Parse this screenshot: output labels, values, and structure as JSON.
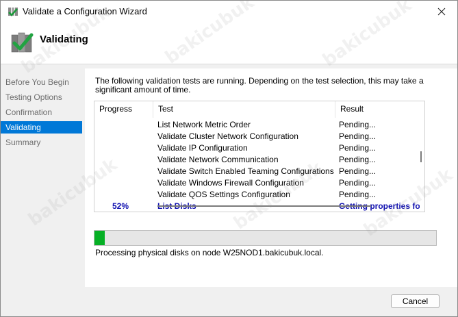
{
  "window": {
    "title": "Validate a Configuration Wizard"
  },
  "header": {
    "title": "Validating"
  },
  "sidebar": {
    "items": [
      {
        "label": "Before You Begin",
        "active": false
      },
      {
        "label": "Testing Options",
        "active": false
      },
      {
        "label": "Confirmation",
        "active": false
      },
      {
        "label": "Validating",
        "active": true
      },
      {
        "label": "Summary",
        "active": false
      }
    ]
  },
  "main": {
    "intro": "The following validation tests are running. Depending on the test selection, this may take a significant amount of time.",
    "columns": {
      "progress": "Progress",
      "test": "Test",
      "result": "Result"
    },
    "rows": [
      {
        "progress": "",
        "test": "List Network Metric Order",
        "result": "Pending..."
      },
      {
        "progress": "",
        "test": "Validate Cluster Network Configuration",
        "result": "Pending..."
      },
      {
        "progress": "",
        "test": "Validate IP Configuration",
        "result": "Pending..."
      },
      {
        "progress": "",
        "test": "Validate Network Communication",
        "result": "Pending..."
      },
      {
        "progress": "",
        "test": "Validate Switch Enabled Teaming Configurations",
        "result": "Pending..."
      },
      {
        "progress": "",
        "test": "Validate Windows Firewall Configuration",
        "result": "Pending..."
      },
      {
        "progress": "",
        "test": "Validate QOS Settings Configuration",
        "result": "Pending..."
      },
      {
        "progress": "52%",
        "test": "List Disks",
        "result": "Getting properties for p",
        "current": true
      }
    ],
    "progress_fraction": 0.03,
    "status": "Processing physical disks on node W25NOD1.bakicubuk.local."
  },
  "footer": {
    "cancel_label": "Cancel"
  },
  "watermark": "bakicubuk",
  "colors": {
    "accent": "#0078d7",
    "progress": "#06b025",
    "current_row": "#1010b0"
  }
}
